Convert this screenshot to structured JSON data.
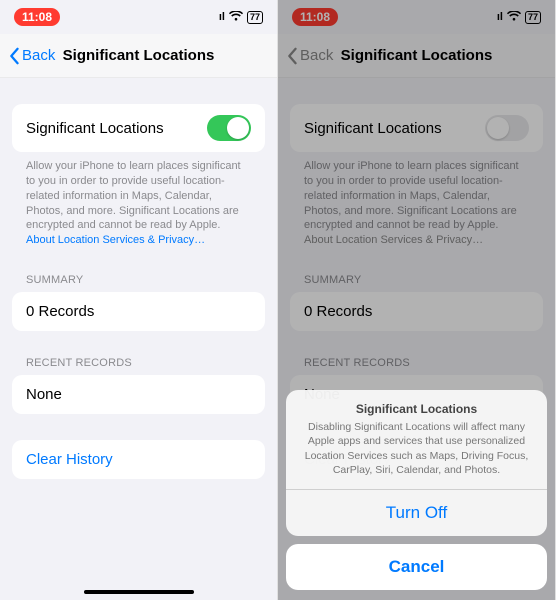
{
  "status": {
    "time": "11:08",
    "signal": "••ıl",
    "wifi": "wifi",
    "battery": "77"
  },
  "nav": {
    "back_label": "Back",
    "title": "Significant Locations"
  },
  "toggle_row": {
    "label": "Significant Locations"
  },
  "footer": {
    "text": "Allow your iPhone to learn places significant to you in order to provide useful location-related information in Maps, Calendar, Photos, and more. Significant Locations are encrypted and cannot be read by Apple.",
    "link": "About Location Services & Privacy…"
  },
  "summary": {
    "header": "SUMMARY",
    "value": "0 Records"
  },
  "recent": {
    "header": "RECENT RECORDS",
    "value": "None"
  },
  "clear_history": {
    "label": "Clear History"
  },
  "action_sheet": {
    "title": "Significant Locations",
    "message": "Disabling Significant Locations will affect many Apple apps and services that use personalized Location Services such as Maps, Driving Focus, CarPlay, Siri, Calendar, and Photos.",
    "turn_off": "Turn Off",
    "cancel": "Cancel"
  }
}
